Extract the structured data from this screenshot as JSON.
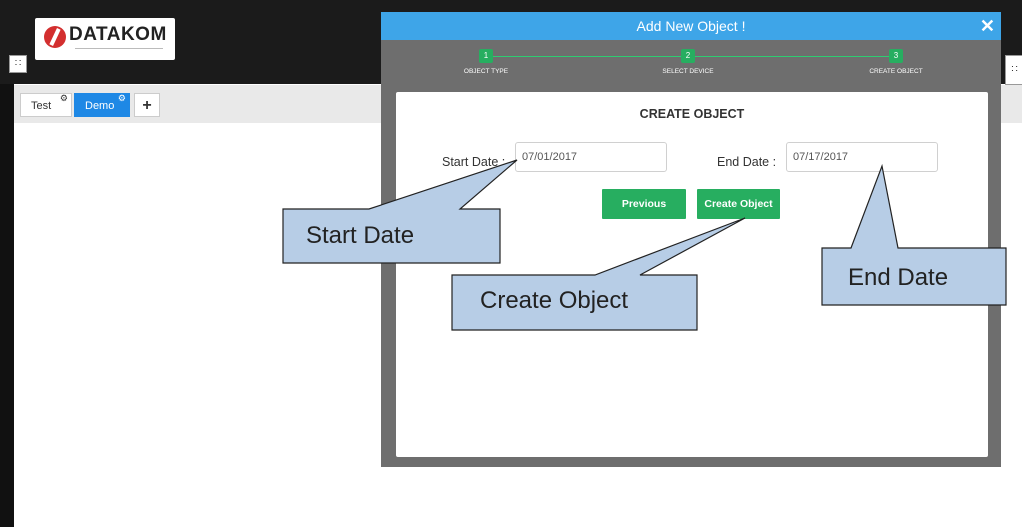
{
  "app": {
    "logo_text": "DATAKOM",
    "grid_icon": "apps-grid-icon"
  },
  "tabs": [
    {
      "label": "Test",
      "icon": "gear-icon"
    },
    {
      "label": "Demo",
      "icon": "gear-icon"
    }
  ],
  "add_tab_label": "+",
  "modal": {
    "title": "Add New Object !",
    "close_label": "✕",
    "steps": [
      {
        "number": "1",
        "label": "OBJECT TYPE"
      },
      {
        "number": "2",
        "label": "SELECT DEVICE"
      },
      {
        "number": "3",
        "label": "CREATE OBJECT"
      }
    ],
    "panel_title": "CREATE OBJECT",
    "start_date_label": "Start Date :",
    "start_date_value": "07/01/2017",
    "end_date_label": "End Date :",
    "end_date_value": "07/17/2017",
    "previous_label": "Previous",
    "create_label": "Create Object"
  },
  "callouts": {
    "start_date": "Start Date",
    "create_object": "Create Object",
    "end_date": "End Date"
  },
  "colors": {
    "header_blue": "#3ea5e8",
    "button_green": "#27ae60",
    "active_tab": "#1e88e5"
  }
}
